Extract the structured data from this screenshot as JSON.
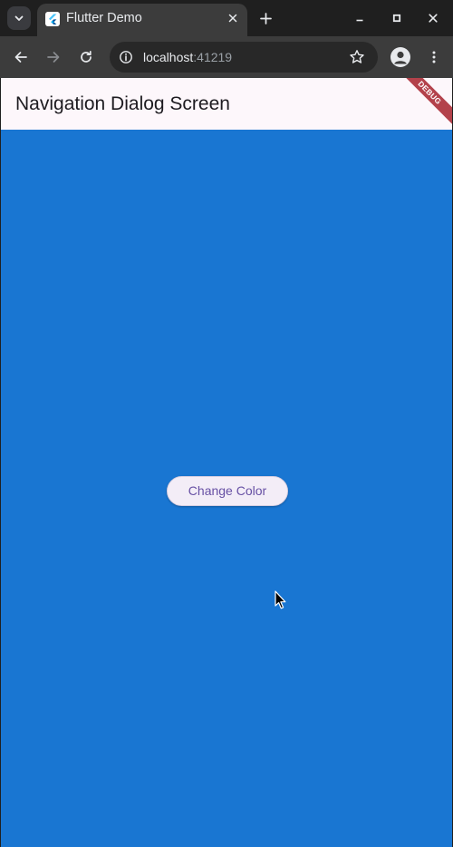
{
  "browser": {
    "tab": {
      "title": "Flutter Demo",
      "favicon": "flutter-logo-icon"
    },
    "address_bar": {
      "host": "localhost",
      "port": ":41219"
    },
    "icons": {
      "tab_search": "chevron-down-icon",
      "close_tab": "close-icon",
      "new_tab": "plus-icon",
      "minimize": "minimize-icon",
      "maximize": "maximize-icon",
      "close_window": "close-icon",
      "back": "arrow-left-icon",
      "forward": "arrow-right-icon",
      "reload": "reload-icon",
      "site_info": "info-icon",
      "bookmark": "star-icon",
      "profile": "person-icon",
      "menu": "kebab-menu-icon"
    }
  },
  "app": {
    "title": "Navigation Dialog Screen",
    "debug_banner": "DEBUG",
    "button_label": "Change Color",
    "colors": {
      "background": "#1976d2",
      "appbar": "#fdf7fb",
      "button_bg": "#f3edf7",
      "button_text": "#6750a4",
      "debug_banner": "#b3424b"
    }
  }
}
